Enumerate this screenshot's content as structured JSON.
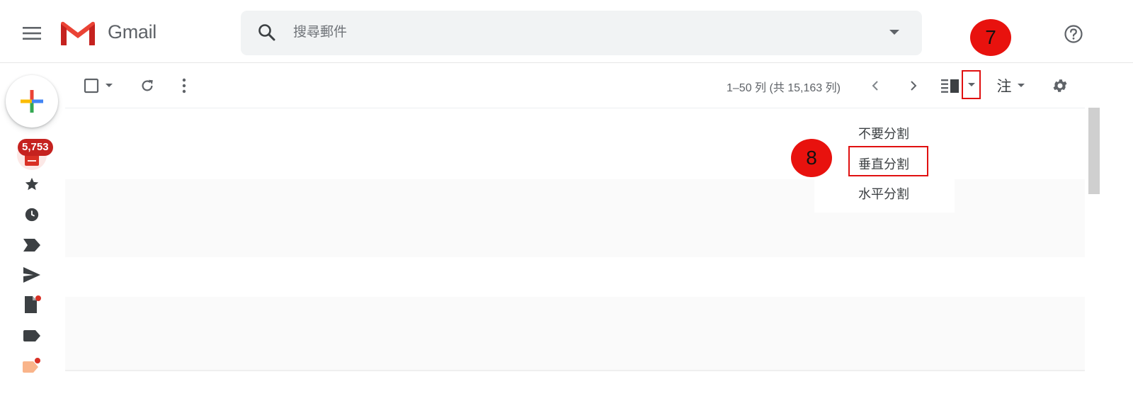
{
  "header": {
    "app_name": "Gmail",
    "search_placeholder": "搜尋郵件"
  },
  "sidebar": {
    "inbox_badge": "5,753"
  },
  "toolbar": {
    "page_count": "1–50 列 (共 15,163 列)",
    "input_tools_label": "注"
  },
  "split_menu": {
    "items": [
      "不要分割",
      "垂直分割",
      "水平分割"
    ],
    "highlighted_index": 1
  },
  "annotations": {
    "step7": "7",
    "step8": "8"
  },
  "colors": {
    "annotation_red": "#e8120e",
    "badge_red": "#c5221f",
    "gmail_red": "#ea4335",
    "icon_gray": "#5f6368"
  }
}
